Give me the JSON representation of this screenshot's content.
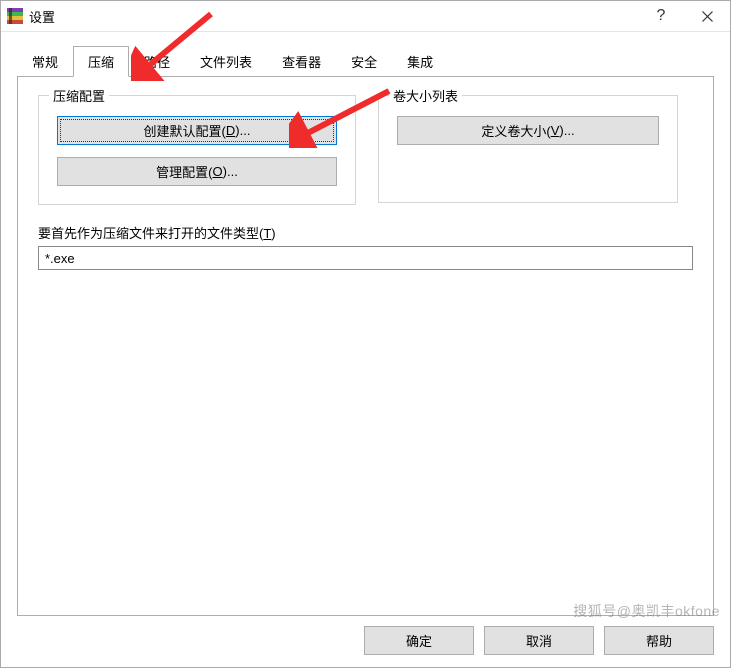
{
  "window": {
    "title": "设置",
    "help_symbol": "?",
    "close_symbol": "×"
  },
  "tabs": {
    "items": [
      {
        "label": "常规"
      },
      {
        "label": "压缩"
      },
      {
        "label": "路径"
      },
      {
        "label": "文件列表"
      },
      {
        "label": "查看器"
      },
      {
        "label": "安全"
      },
      {
        "label": "集成"
      }
    ],
    "active_index": 1
  },
  "groups": {
    "left": {
      "title": "压缩配置",
      "btn_default_prefix": "创建默认配置(",
      "btn_default_key": "D",
      "btn_default_suffix": ")...",
      "btn_manage_prefix": "管理配置(",
      "btn_manage_key": "O",
      "btn_manage_suffix": ")..."
    },
    "right": {
      "title": "卷大小列表",
      "btn_volume_prefix": "定义卷大小(",
      "btn_volume_key": "V",
      "btn_volume_suffix": ")..."
    }
  },
  "field": {
    "label_prefix": "要首先作为压缩文件来打开的文件类型(",
    "label_key": "T",
    "label_suffix": ")",
    "value": "*.exe"
  },
  "footer": {
    "ok": "确定",
    "cancel": "取消",
    "help": "帮助"
  },
  "watermark": "搜狐号@奥凯丰okfone"
}
